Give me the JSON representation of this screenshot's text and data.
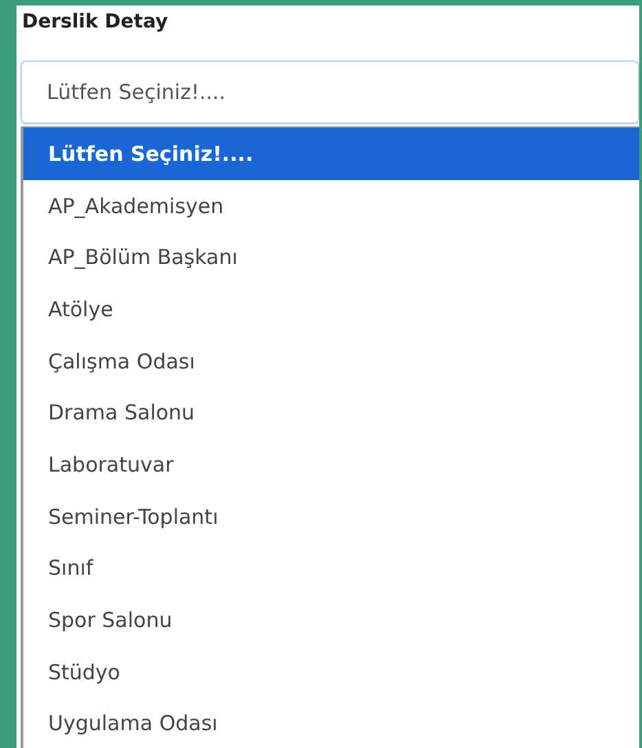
{
  "label": "Derslik Detay",
  "select": {
    "value": "Lütfen Seçiniz!...."
  },
  "options": [
    {
      "label": "Lütfen Seçiniz!....",
      "selected": true
    },
    {
      "label": "AP_Akademisyen",
      "selected": false
    },
    {
      "label": "AP_Bölüm Başkanı",
      "selected": false
    },
    {
      "label": "Atölye",
      "selected": false
    },
    {
      "label": "Çalışma Odası",
      "selected": false
    },
    {
      "label": "Drama Salonu",
      "selected": false
    },
    {
      "label": "Laboratuvar",
      "selected": false
    },
    {
      "label": "Seminer-Toplantı",
      "selected": false
    },
    {
      "label": "Sınıf",
      "selected": false
    },
    {
      "label": "Spor Salonu",
      "selected": false
    },
    {
      "label": "Stüdyo",
      "selected": false
    },
    {
      "label": "Uygulama Odası",
      "selected": false
    }
  ]
}
